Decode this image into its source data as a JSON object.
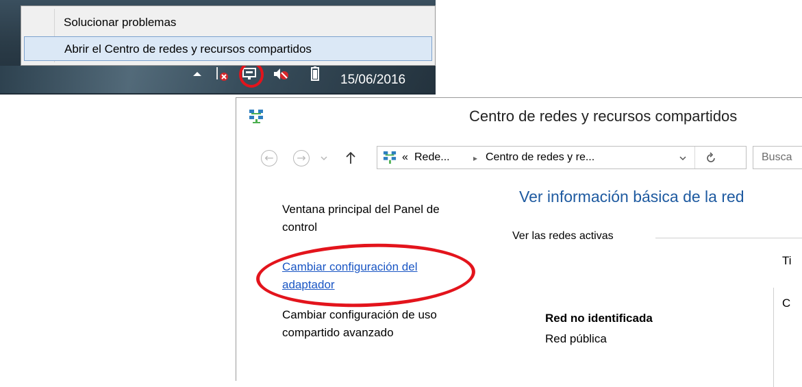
{
  "context_menu": {
    "items": [
      {
        "label": "Solucionar problemas"
      },
      {
        "label": "Abrir el Centro de redes y recursos compartidos"
      }
    ]
  },
  "taskbar": {
    "date": "15/06/2016",
    "icons": [
      "show-hidden-icons-arrow-icon",
      "action-center-error-icon",
      "network-icon",
      "volume-muted-icon",
      "battery-icon"
    ]
  },
  "window": {
    "title": "Centro de redes y recursos compartidos",
    "address": {
      "chevrons": "«",
      "seg1": "Rede...",
      "sep": "▸",
      "seg2": "Centro de redes y re..."
    },
    "search_placeholder": "Busca",
    "sidebar": {
      "items": [
        {
          "label_line1": "Ventana principal del Panel de",
          "label_line2": "control"
        },
        {
          "label_line1": "Cambiar configuración del",
          "label_line2": "adaptador"
        },
        {
          "label_line1": "Cambiar configuración de uso",
          "label_line2": "compartido avanzado"
        }
      ]
    },
    "main": {
      "heading": "Ver información básica de la red",
      "active_networks_label": "Ver las redes activas",
      "network_name": "Red no identificada",
      "network_type": "Red pública",
      "col_cut_1": "Ti",
      "col_cut_2": "C"
    }
  },
  "colors": {
    "link": "#1a56c4",
    "heading": "#1e5aa0",
    "highlight": "#e3141c"
  }
}
